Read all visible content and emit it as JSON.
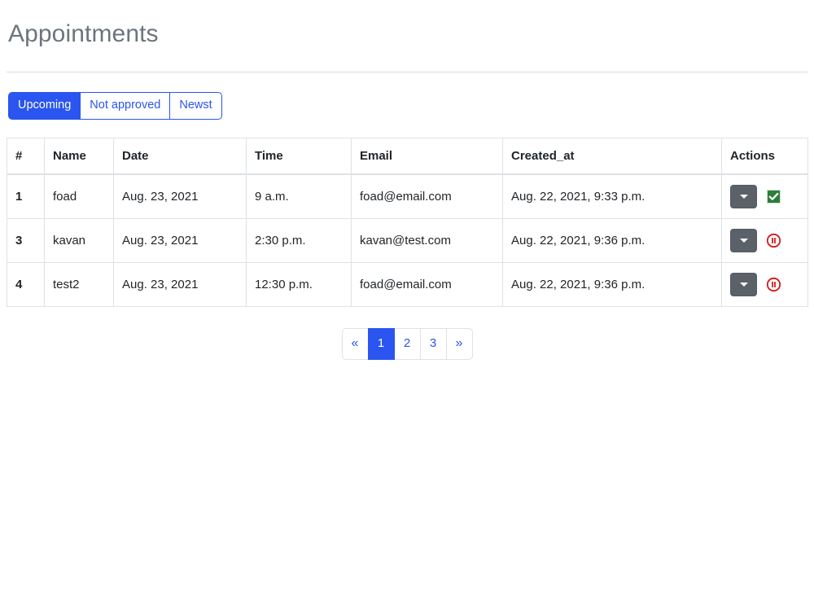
{
  "page": {
    "title": "Appointments"
  },
  "filters": {
    "items": [
      {
        "label": "Upcoming",
        "active": true
      },
      {
        "label": "Not approved",
        "active": false
      },
      {
        "label": "Newst",
        "active": false
      }
    ]
  },
  "table": {
    "columns": [
      "#",
      "Name",
      "Date",
      "Time",
      "Email",
      "Created_at",
      "Actions"
    ],
    "rows": [
      {
        "id": "1",
        "name": "foad",
        "date": "Aug. 23, 2021",
        "time": "9 a.m.",
        "email": "foad@email.com",
        "created_at": "Aug. 22, 2021, 9:33 p.m.",
        "dropdown_icon": "caret-down-icon",
        "status_icon": "approved-check-icon"
      },
      {
        "id": "3",
        "name": "kavan",
        "date": "Aug. 23, 2021",
        "time": "2:30 p.m.",
        "email": "kavan@test.com",
        "created_at": "Aug. 22, 2021, 9:36 p.m.",
        "dropdown_icon": "caret-down-icon",
        "status_icon": "pending-pause-icon"
      },
      {
        "id": "4",
        "name": "test2",
        "date": "Aug. 23, 2021",
        "time": "12:30 p.m.",
        "email": "foad@email.com",
        "created_at": "Aug. 22, 2021, 9:36 p.m.",
        "dropdown_icon": "caret-down-icon",
        "status_icon": "pending-pause-icon"
      }
    ]
  },
  "pagination": {
    "items": [
      {
        "label": "«",
        "active": false,
        "kind": "prev"
      },
      {
        "label": "1",
        "active": true,
        "kind": "page"
      },
      {
        "label": "2",
        "active": false,
        "kind": "page"
      },
      {
        "label": "3",
        "active": false,
        "kind": "page"
      },
      {
        "label": "»",
        "active": false,
        "kind": "next"
      }
    ]
  },
  "colors": {
    "primary": "#2a55f0",
    "title_text": "#6c757d",
    "border": "#dee2e6",
    "dropdown_bg": "#5a6169",
    "approved_green": "#2e7d39",
    "pending_red": "#d01b1b"
  }
}
